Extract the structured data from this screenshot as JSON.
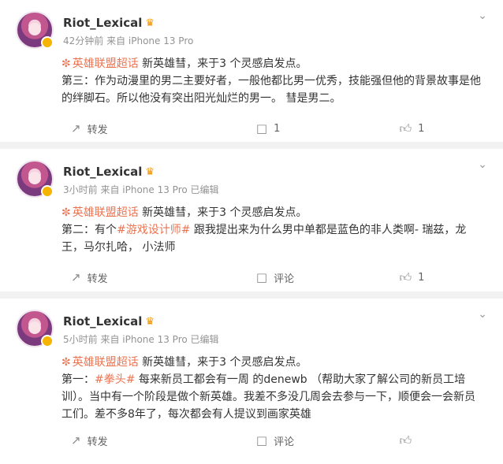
{
  "posts": [
    {
      "author": "Riot_Lexical",
      "meta": "42分钟前  来自 iPhone 13 Pro",
      "topic": "英雄联盟超话",
      "headline": " 新英雄彗，来于3 个灵感启发点。",
      "paragraph_html": "第三：作为动漫里的男二主要好者，一般他都比男一优秀，技能强但他的背景故事是他的绊脚石。所以他没有突出阳光灿烂的男一。 彗是男二。",
      "actions": {
        "share": "转发",
        "comment": "1",
        "like": "1"
      }
    },
    {
      "author": "Riot_Lexical",
      "meta": "3小时前  来自 iPhone 13 Pro 已编辑",
      "topic": "英雄联盟超话",
      "headline": " 新英雄彗，来于3 个灵感启发点。",
      "para_pre": "第二：有个",
      "para_tag": "#游戏设计师#",
      "para_post": "跟我提出来为什么男中单都是蓝色的非人类啊- 瑞兹，龙王，马尔扎哈， 小法师",
      "actions": {
        "share": "转发",
        "comment": "评论",
        "like": "1"
      }
    },
    {
      "author": "Riot_Lexical",
      "meta": "5小时前  来自 iPhone 13 Pro 已编辑",
      "topic": "英雄联盟超话",
      "headline": " 新英雄彗，来于3 个灵感启发点。",
      "para_pre": "第一：",
      "para_tag": "#拳头#",
      "para_post": "每来新员工都会有一周 的denewb （帮助大家了解公司的新员工培训）。当中有一个阶段是做个新英雄。我差不多没几周会去参与一下，顺便会一会新员工们。差不多8年了，每次都会有人提议到画家英雄",
      "actions": {
        "share": "转发",
        "comment": "评论",
        "like": ""
      }
    }
  ],
  "icons": {
    "more": "chevron-down-icon",
    "share": "share-icon",
    "comment": "comment-icon",
    "like": "thumbs-up-icon"
  },
  "colors": {
    "topic": "#eb7350",
    "crown": "#f29100",
    "badge": "#f5b400"
  }
}
